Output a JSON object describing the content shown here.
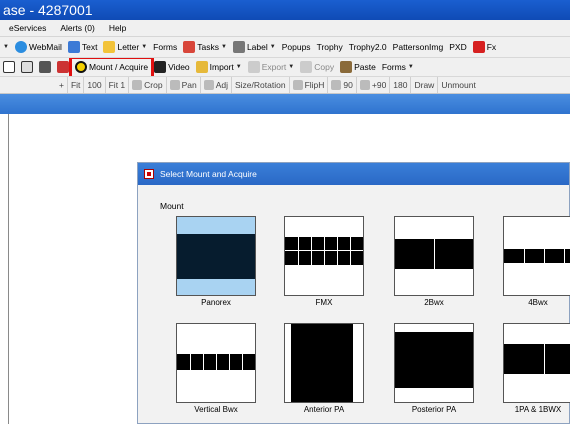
{
  "window": {
    "title": "ase - 4287001"
  },
  "menu": [
    "eServices",
    "Alerts (0)",
    "Help"
  ],
  "toolbar1": [
    {
      "label": "WebMail",
      "icon": "webmail-icon"
    },
    {
      "label": "Text",
      "icon": "text-icon"
    },
    {
      "label": "Letter",
      "icon": "letter-icon"
    },
    {
      "label": "Forms",
      "icon": ""
    },
    {
      "label": "Tasks",
      "icon": "tasks-icon"
    },
    {
      "label": "Label",
      "icon": "label-icon"
    },
    {
      "label": "Popups",
      "icon": ""
    },
    {
      "label": "Trophy",
      "icon": ""
    },
    {
      "label": "Trophy2.0",
      "icon": ""
    },
    {
      "label": "PattersonImg",
      "icon": ""
    },
    {
      "label": "PXD",
      "icon": ""
    },
    {
      "label": "Fx",
      "icon": "rx-icon"
    }
  ],
  "toolbar2": {
    "mount_acquire": "Mount / Acquire",
    "video": "Video",
    "import": "Import",
    "export": "Export",
    "copy": "Copy",
    "paste": "Paste",
    "forms": "Forms"
  },
  "toolbar3": [
    "Fit",
    "100",
    "Fit 1",
    "Crop",
    "Pan",
    "Adj",
    "Size/Rotation",
    "FlipH",
    "90",
    "+90",
    "180",
    "Draw",
    "Unmount"
  ],
  "dialog": {
    "title": "Select Mount and Acquire",
    "section_label": "Mount",
    "mounts": [
      "Panorex",
      "FMX",
      "2Bwx",
      "4Bwx",
      "Vertical Bwx",
      "Anterior PA",
      "Posterior PA",
      "1PA & 1BWX"
    ]
  },
  "colors": {
    "titlebar": "#1a5fd0",
    "highlight_border": "#e01010",
    "selected_tile": "#a9d3f2",
    "dialog_title": "#3a7fd8"
  }
}
